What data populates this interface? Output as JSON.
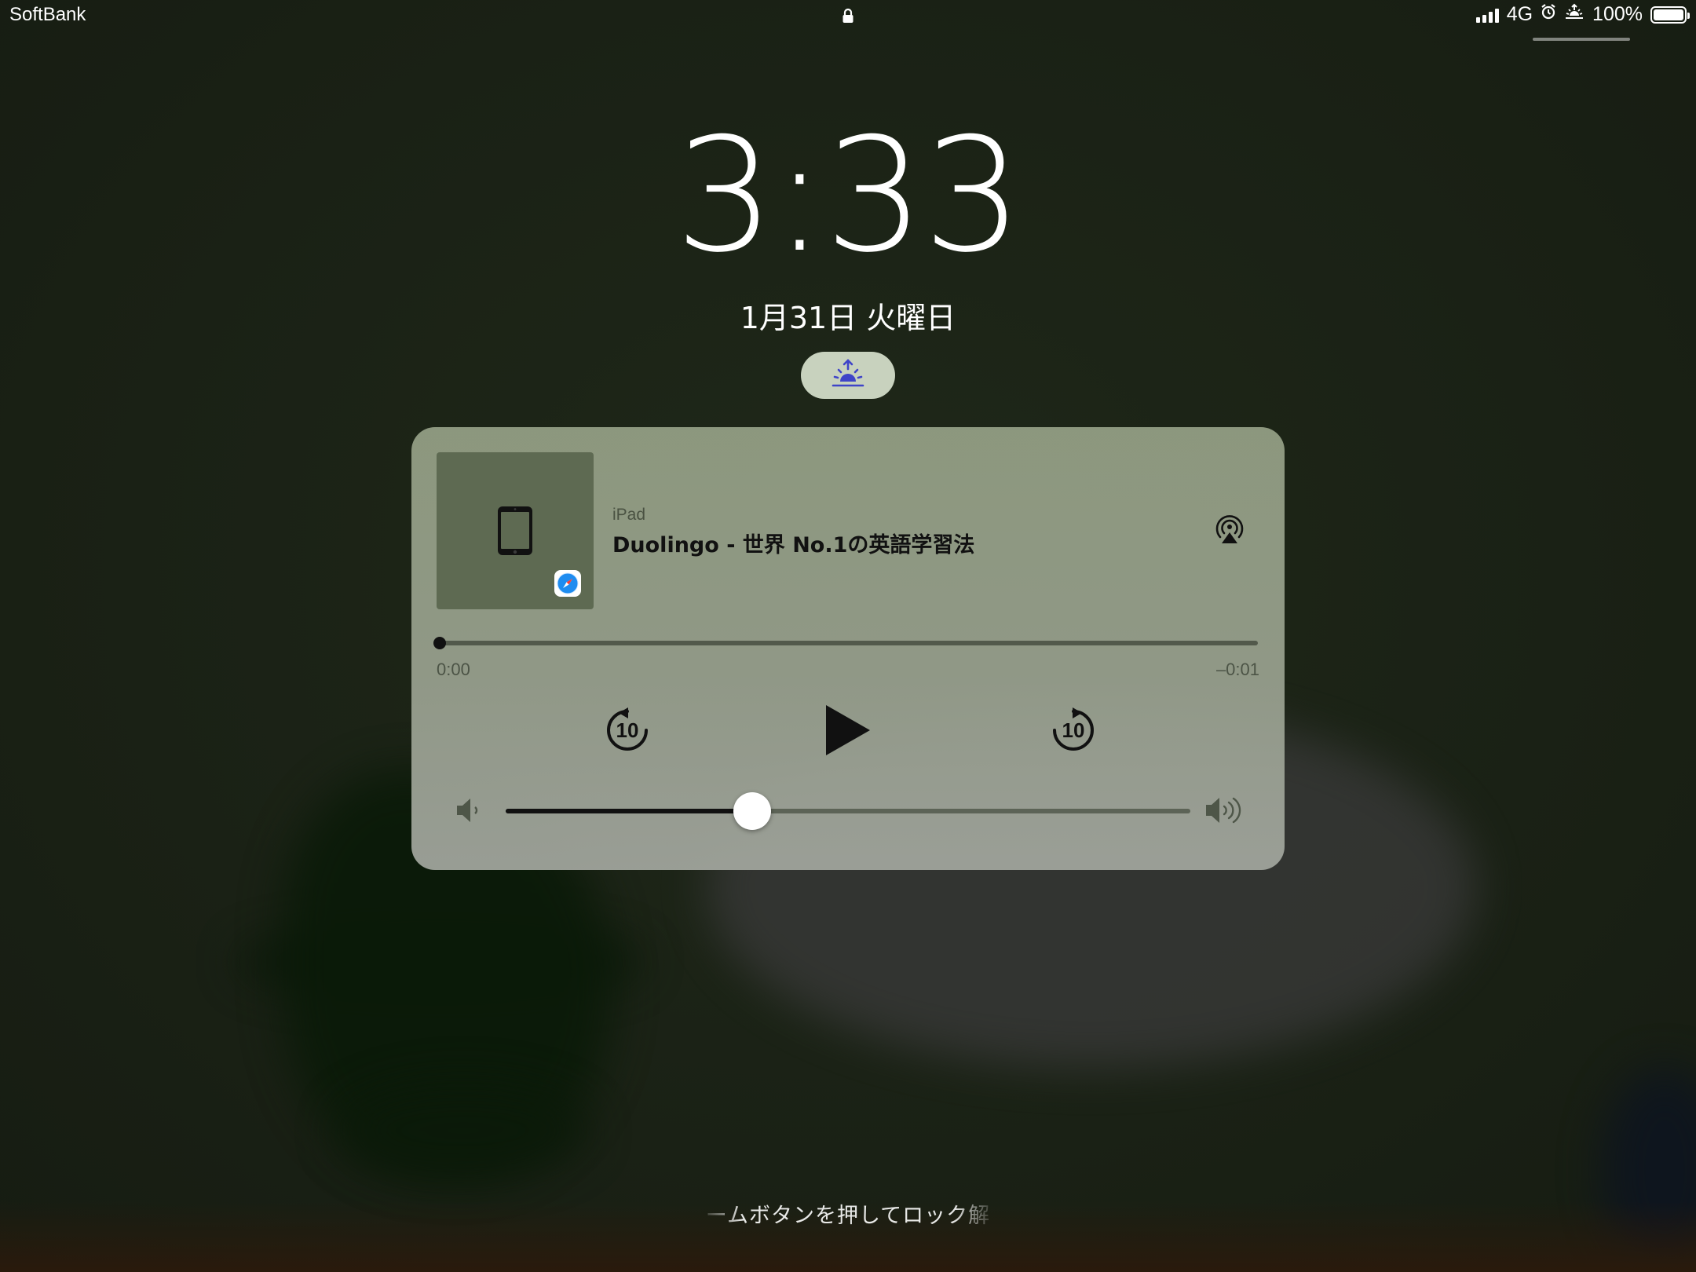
{
  "status_bar": {
    "carrier": "SoftBank",
    "network": "4G",
    "battery_percent": "100%",
    "battery_level": 1.0,
    "signal_bars": 4
  },
  "lock_screen": {
    "time": "3:33",
    "date": "1月31日 火曜日",
    "unlock_hint": "ームボタンを押してロック解"
  },
  "now_playing": {
    "source": "iPad",
    "title": "Duolingo - 世界 No.1の英語学習法",
    "elapsed": "0:00",
    "remaining": "–0:01",
    "progress": 0.0,
    "skip_back_seconds": "10",
    "skip_forward_seconds": "10",
    "volume": 0.36
  },
  "colors": {
    "accent_indigo": "#3f44c8",
    "card_bg": "#919c82",
    "safari_blue": "#1e8cf0"
  }
}
